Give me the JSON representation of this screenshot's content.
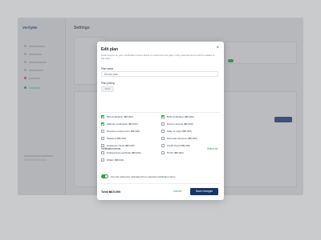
{
  "background": {
    "app_logo": "VerifyMe",
    "page_title": "Settings"
  },
  "modal": {
    "title": "Edit plan",
    "close_icon": "close-icon",
    "description": "Select items on your verification items sheet to customize the plan. Only selected items will be added to the plan.",
    "plan_name": {
      "label": "Plan name",
      "placeholder": "Bronze plan"
    },
    "plan_pricing": {
      "label": "Plan pricing",
      "value": "5025"
    },
    "verification_items_label": "Verification items",
    "select_all_label": "Select all",
    "items_left": [
      {
        "label": "NIN verification (₦5,000)",
        "checked": true
      },
      {
        "label": "Address verification (₦5,000)",
        "checked": true
      },
      {
        "label": "Previous employment (₦5,000)",
        "checked": false
      },
      {
        "label": "Passport (₦5,000)",
        "checked": false
      },
      {
        "label": "Guarantor check (₦5,000)",
        "checked": false
      },
      {
        "label": "Professional certificate (₦5,000)",
        "checked": false
      },
      {
        "label": "WAEC (₦5,000)",
        "checked": false
      }
    ],
    "items_right": [
      {
        "label": "BVN verification (₦5,000)",
        "checked": true
      },
      {
        "label": "Driver's license (₦5,000)",
        "checked": false
      },
      {
        "label": "State of origin (₦5,000)",
        "checked": false
      },
      {
        "label": "Personal reference (₦5,000)",
        "checked": false
      },
      {
        "label": "Credit check (₦5,000)",
        "checked": false
      },
      {
        "label": "NYSC (₦5,000)",
        "checked": false
      }
    ],
    "toggle": {
      "on": true,
      "label": "Use the total price calculated from selected verification items"
    },
    "total": "Total ₦15,000",
    "cancel_label": "Cancel",
    "save_label": "Save changes"
  },
  "colors": {
    "accent_green": "#2da04f",
    "primary_navy": "#15356b"
  }
}
